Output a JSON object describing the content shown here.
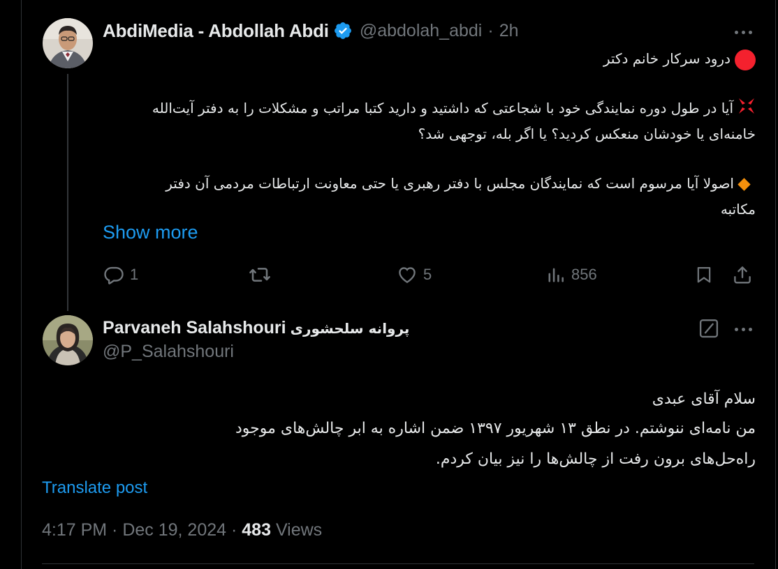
{
  "colors": {
    "background": "#000000",
    "text": "#e7e9ea",
    "muted": "#71767b",
    "accent": "#1d9bf0",
    "verified": "#1d9bf0",
    "red_circle": "#f4212e",
    "orange_diamond": "#f4900c"
  },
  "post": {
    "author_name": "AbdiMedia - Abdollah Abdi",
    "handle": "@abdolah_abdi",
    "separator": "·",
    "time": "2h",
    "lines": [
      {
        "icon": "red-circle-icon",
        "text": "درود سرکار خانم دکتر"
      },
      {
        "icon": "anger-icon",
        "text": "آیا در طول دوره نمایندگی خود با شجاعتی که داشتید و دارید کتبا مراتب و مشکلات را به دفتر آیت‌الله"
      },
      {
        "icon": "",
        "text": "خامنه‌ای یا خودشان منعکس کردید؟ یا اگر بله، توجهی شد؟"
      },
      {
        "icon": "orange-diamond-icon",
        "text": "اصولا آیا مرسوم است که نمایندگان مجلس با دفتر رهبری یا حتی معاونت ارتباطات مردمی آن دفتر"
      },
      {
        "icon": "",
        "text": "مکاتبه"
      }
    ],
    "show_more": "Show more",
    "actions": {
      "reply_count": "1",
      "like_count": "5",
      "views_count": "856"
    }
  },
  "reply": {
    "author_name": "Parvaneh Salahshouri",
    "author_name_fa": "پروانه سلحشوری",
    "handle": "@P_Salahshouri",
    "lines": [
      "سلام آقای عبدی",
      "من نامه‌ای ننوشتم. در نطق ۱۳ شهریور ۱۳۹۷ ضمن اشاره به ابر چالش‌های موجود",
      "راه‌حل‌های برون رفت از چالش‌ها را نیز بیان کردم."
    ],
    "translate": "Translate post",
    "timestamp": "4:17 PM · Dec 19, 2024 ·",
    "views_count": "483",
    "views_label": "Views"
  }
}
